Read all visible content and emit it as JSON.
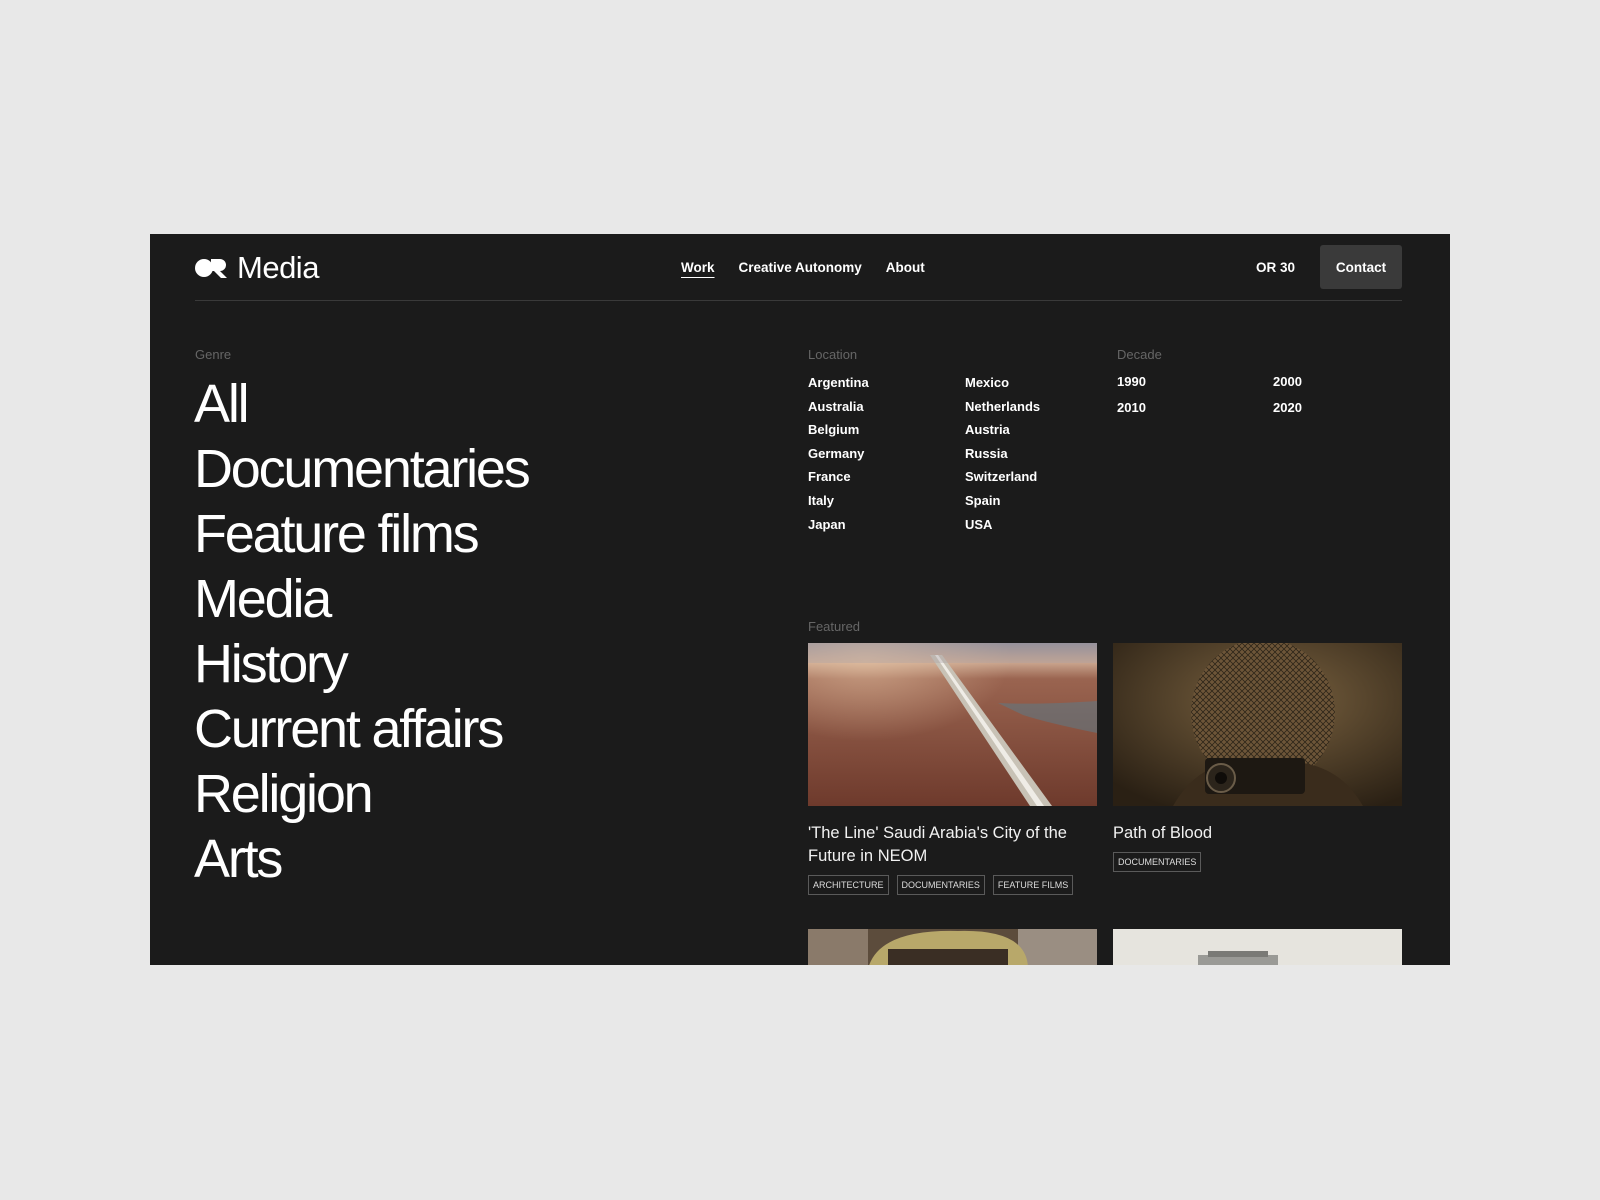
{
  "brand": {
    "name": "Media"
  },
  "nav": {
    "items": [
      {
        "label": "Work",
        "active": true
      },
      {
        "label": "Creative Autonomy",
        "active": false
      },
      {
        "label": "About",
        "active": false
      }
    ]
  },
  "header": {
    "or30_label": "OR 30",
    "contact_label": "Contact"
  },
  "genre": {
    "label": "Genre",
    "items": [
      "All",
      "Documentaries",
      "Feature films",
      "Media",
      "History",
      "Current affairs",
      "Religion",
      "Arts"
    ]
  },
  "location": {
    "label": "Location",
    "items": [
      "Argentina",
      "Australia",
      "Belgium",
      "Germany",
      "France",
      "Italy",
      "Japan",
      "Mexico",
      "Netherlands",
      "Austria",
      "Russia",
      "Switzerland",
      "Spain",
      "USA"
    ]
  },
  "decade": {
    "label": "Decade",
    "items": [
      "1990",
      "2000",
      "2010",
      "2020"
    ]
  },
  "featured": {
    "label": "Featured",
    "cards": [
      {
        "title": "'The Line' Saudi Arabia's City of the Future in NEOM",
        "tags": [
          "Architecture",
          "Documentaries",
          "Feature films"
        ]
      },
      {
        "title": "Path of Blood",
        "tags": [
          "Documentaries"
        ]
      }
    ]
  },
  "colors": {
    "frame_bg": "#1b1b1b",
    "page_bg": "#e8e8e8",
    "contact_bg": "#3a3a3a"
  }
}
